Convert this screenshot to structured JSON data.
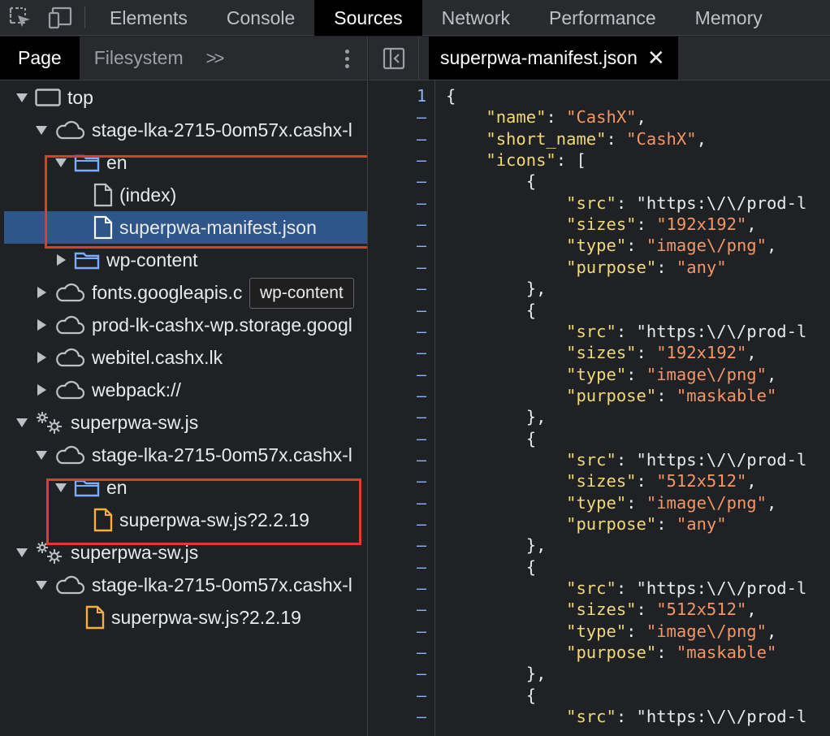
{
  "toolbar": {
    "inspect_icon": "inspect-element-icon",
    "device_icon": "device-toolbar-icon",
    "tabs": [
      "Elements",
      "Console",
      "Sources",
      "Network",
      "Performance",
      "Memory"
    ],
    "active_tab": "Sources"
  },
  "navigator": {
    "tabs": {
      "page": "Page",
      "filesystem": "Filesystem",
      "more": ">>"
    },
    "active_tab": "Page",
    "tree": [
      {
        "label": "top",
        "icon": "frame-icon",
        "expanded": true
      },
      {
        "label": "stage-lka-2715-0om57x.cashx-l",
        "icon": "cloud-icon",
        "expanded": true
      },
      {
        "label": "en",
        "icon": "folder-icon",
        "expanded": true
      },
      {
        "label": "(index)",
        "icon": "file-icon"
      },
      {
        "label": "superpwa-manifest.json",
        "icon": "file-icon",
        "selected": true
      },
      {
        "label": "wp-content",
        "icon": "folder-icon",
        "expanded": false
      },
      {
        "label": "fonts.googleapis.c",
        "icon": "cloud-icon",
        "expanded": false
      },
      {
        "label": "prod-lk-cashx-wp.storage.googl",
        "icon": "cloud-icon",
        "expanded": false
      },
      {
        "label": "webitel.cashx.lk",
        "icon": "cloud-icon",
        "expanded": false
      },
      {
        "label": "webpack://",
        "icon": "cloud-icon",
        "expanded": false
      },
      {
        "label": "superpwa-sw.js",
        "icon": "service-worker-gear-icon",
        "expanded": true
      },
      {
        "label": "stage-lka-2715-0om57x.cashx-l",
        "icon": "cloud-icon",
        "expanded": true
      },
      {
        "label": "en",
        "icon": "folder-icon",
        "expanded": true
      },
      {
        "label": "superpwa-sw.js?2.2.19",
        "icon": "script-file-icon"
      },
      {
        "label": "superpwa-sw.js",
        "icon": "service-worker-gear-icon",
        "expanded": true
      },
      {
        "label": "stage-lka-2715-0om57x.cashx-l",
        "icon": "cloud-icon",
        "expanded": true
      },
      {
        "label": "superpwa-sw.js?2.2.19",
        "icon": "script-file-icon"
      }
    ],
    "tooltip": "wp-content"
  },
  "editor": {
    "open_file": "superpwa-manifest.json",
    "first_line_number": "1",
    "folded_marker": "–",
    "colors": {
      "key": "#f0d97a",
      "string": "#f29766",
      "line_number": "#8ab4f8",
      "highlight_box": "#e8382d",
      "selection": "#2e5688"
    },
    "code_lines": [
      "{",
      "    \"name\": \"CashX\",",
      "    \"short_name\": \"CashX\",",
      "    \"icons\": [",
      "        {",
      "            \"src\": \"https:\\/\\/prod-l",
      "            \"sizes\": \"192x192\",",
      "            \"type\": \"image\\/png\",",
      "            \"purpose\": \"any\"",
      "        },",
      "        {",
      "            \"src\": \"https:\\/\\/prod-l",
      "            \"sizes\": \"192x192\",",
      "            \"type\": \"image\\/png\",",
      "            \"purpose\": \"maskable\"",
      "        },",
      "        {",
      "            \"src\": \"https:\\/\\/prod-l",
      "            \"sizes\": \"512x512\",",
      "            \"type\": \"image\\/png\",",
      "            \"purpose\": \"any\"",
      "        },",
      "        {",
      "            \"src\": \"https:\\/\\/prod-l",
      "            \"sizes\": \"512x512\",",
      "            \"type\": \"image\\/png\",",
      "            \"purpose\": \"maskable\"",
      "        },",
      "        {",
      "            \"src\": \"https:\\/\\/prod-l"
    ]
  }
}
